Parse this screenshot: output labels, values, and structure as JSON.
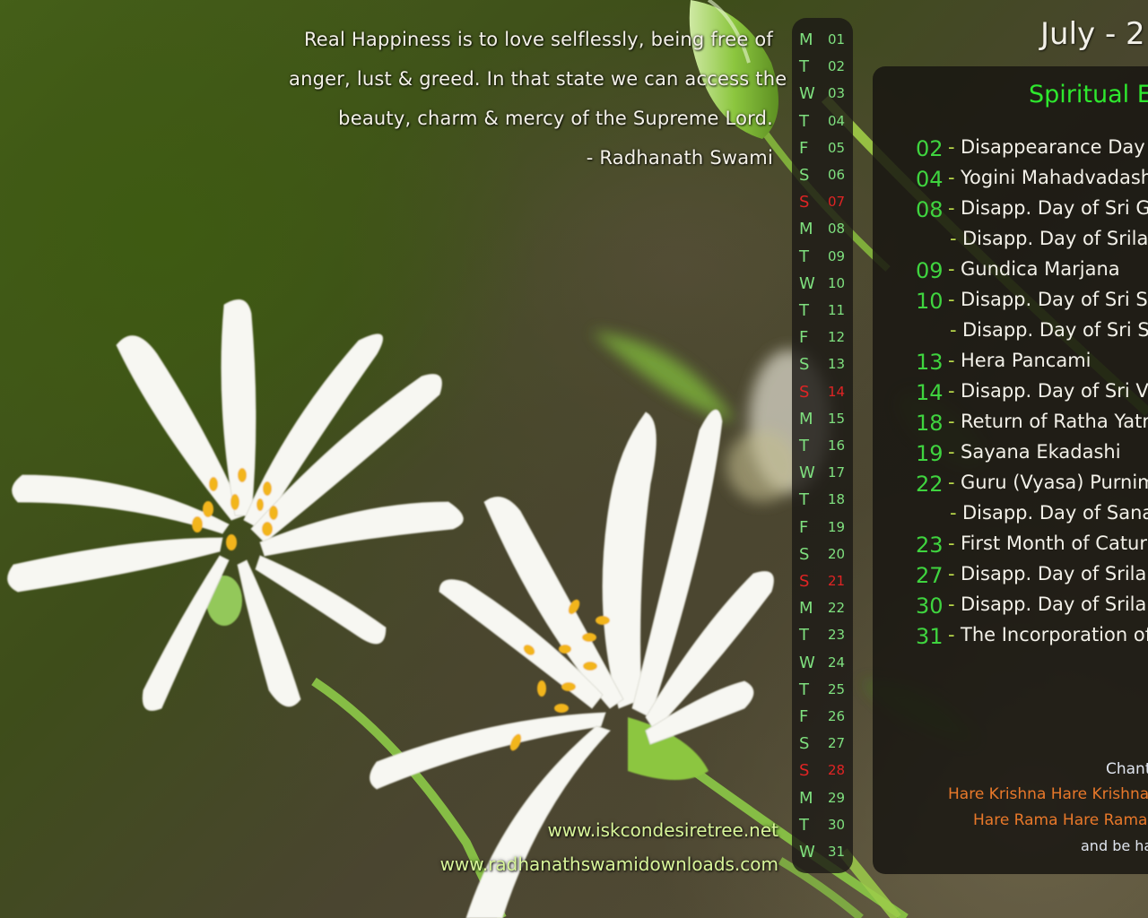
{
  "wallpaper": {
    "subject": "white stitchwort flowers on blurred green background",
    "colors": {
      "background_green": "#3f4a1c",
      "petal_white": "#f7f7f2",
      "stamen_yellow": "#f2b51c",
      "stem_green": "#8cc63f",
      "panel_bg": "#1c1a16",
      "weekday_green": "#7fe07f",
      "sunday_red": "#e02424",
      "event_date_green": "#3fd43f",
      "title_green": "#2ee82e",
      "chant_orange": "#e8782a",
      "site_lime": "#d8f59a"
    }
  },
  "quote": {
    "lines": [
      "Real Happiness is to love selflessly, being free of",
      "anger, lust & greed. In that state we can access the",
      "beauty, charm & mercy of the Supreme Lord.",
      "- Radhanath Swami"
    ]
  },
  "calendar": {
    "month_title": "July - 2",
    "panel_title": "Spiritual E",
    "days": [
      {
        "dow": "M",
        "num": "01",
        "sunday": false
      },
      {
        "dow": "T",
        "num": "02",
        "sunday": false
      },
      {
        "dow": "W",
        "num": "03",
        "sunday": false
      },
      {
        "dow": "T",
        "num": "04",
        "sunday": false
      },
      {
        "dow": "F",
        "num": "05",
        "sunday": false
      },
      {
        "dow": "S",
        "num": "06",
        "sunday": false
      },
      {
        "dow": "S",
        "num": "07",
        "sunday": true
      },
      {
        "dow": "M",
        "num": "08",
        "sunday": false
      },
      {
        "dow": "T",
        "num": "09",
        "sunday": false
      },
      {
        "dow": "W",
        "num": "10",
        "sunday": false
      },
      {
        "dow": "T",
        "num": "11",
        "sunday": false
      },
      {
        "dow": "F",
        "num": "12",
        "sunday": false
      },
      {
        "dow": "S",
        "num": "13",
        "sunday": false
      },
      {
        "dow": "S",
        "num": "14",
        "sunday": true
      },
      {
        "dow": "M",
        "num": "15",
        "sunday": false
      },
      {
        "dow": "T",
        "num": "16",
        "sunday": false
      },
      {
        "dow": "W",
        "num": "17",
        "sunday": false
      },
      {
        "dow": "T",
        "num": "18",
        "sunday": false
      },
      {
        "dow": "F",
        "num": "19",
        "sunday": false
      },
      {
        "dow": "S",
        "num": "20",
        "sunday": false
      },
      {
        "dow": "S",
        "num": "21",
        "sunday": true
      },
      {
        "dow": "M",
        "num": "22",
        "sunday": false
      },
      {
        "dow": "T",
        "num": "23",
        "sunday": false
      },
      {
        "dow": "W",
        "num": "24",
        "sunday": false
      },
      {
        "dow": "T",
        "num": "25",
        "sunday": false
      },
      {
        "dow": "F",
        "num": "26",
        "sunday": false
      },
      {
        "dow": "S",
        "num": "27",
        "sunday": false
      },
      {
        "dow": "S",
        "num": "28",
        "sunday": true
      },
      {
        "dow": "M",
        "num": "29",
        "sunday": false
      },
      {
        "dow": "T",
        "num": "30",
        "sunday": false
      },
      {
        "dow": "W",
        "num": "31",
        "sunday": false
      }
    ],
    "events": [
      {
        "date": "02",
        "text": "Disappearance Day of Sr"
      },
      {
        "date": "04",
        "text": "Yogini Mahadvadashi"
      },
      {
        "date": "08",
        "text": "Disapp. Day of Sri Gada"
      },
      {
        "date": "",
        "text": "Disapp. Day of Srila Bha"
      },
      {
        "date": "09",
        "text": "Gundica Marjana"
      },
      {
        "date": "10",
        "text": "Disapp. Day of Sri Svar"
      },
      {
        "date": "",
        "text": "Disapp. Day of Sri Sivan"
      },
      {
        "date": "13",
        "text": "Hera Pancami"
      },
      {
        "date": "14",
        "text": "Disapp. Day of Sri Vakr"
      },
      {
        "date": "18",
        "text": "Return of Ratha Yatra"
      },
      {
        "date": "19",
        "text": "Sayana Ekadashi"
      },
      {
        "date": "22",
        "text": "Guru (Vyasa) Purnima"
      },
      {
        "date": "",
        "text": "Disapp. Day of Sanatana"
      },
      {
        "date": "23",
        "text": "First Month of Caturma"
      },
      {
        "date": "27",
        "text": "Disapp. Day of Srila Gop"
      },
      {
        "date": "30",
        "text": "Disapp. Day of Srila Lok"
      },
      {
        "date": "31",
        "text": "The Incorporation of ISK"
      }
    ],
    "dash": "-",
    "chant": {
      "label": "Chant",
      "line1": "Hare Krishna Hare Krishna Kris",
      "line2": "Hare Rama Hare Rama Ram",
      "line3": "and be hap"
    }
  },
  "websites": [
    "www.iskcondesiretree.net",
    "www.radhanathswamidownloads.com"
  ]
}
